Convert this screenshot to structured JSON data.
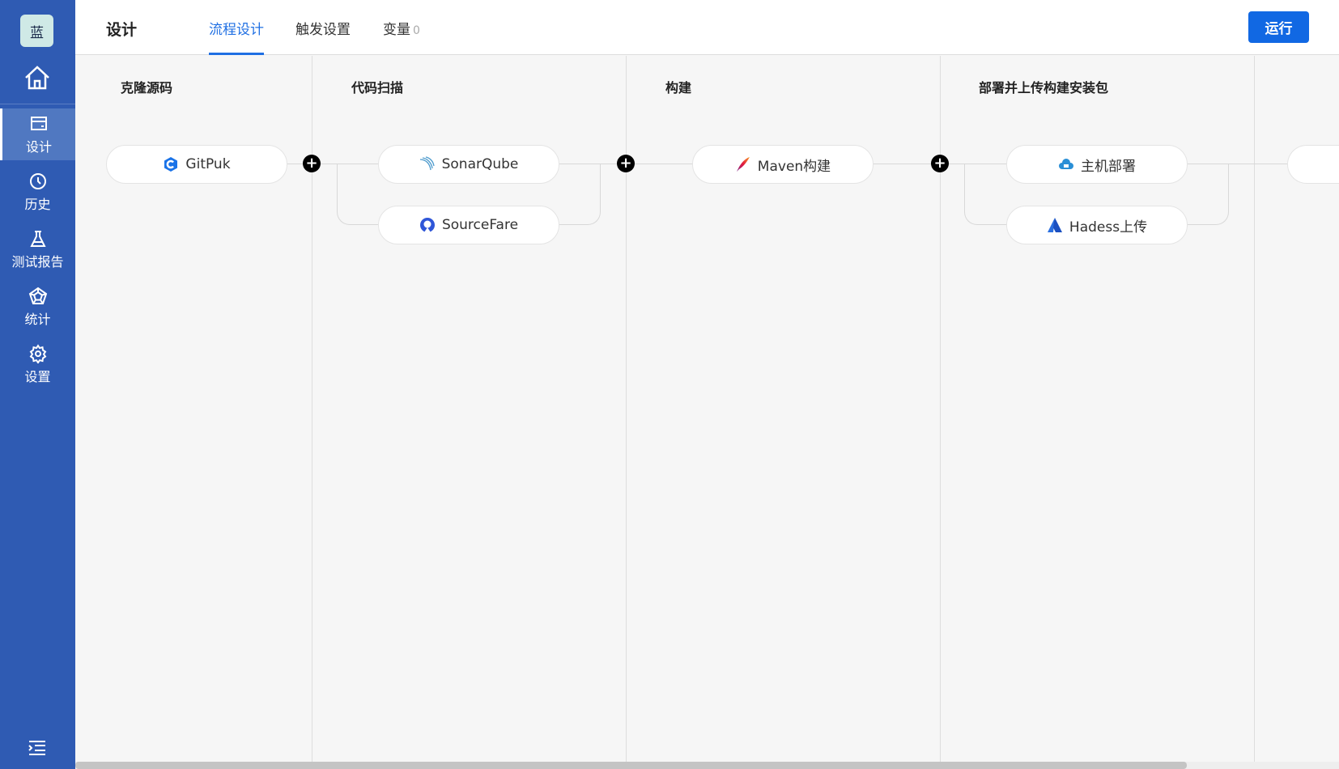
{
  "sidebar": {
    "logo": "蓝",
    "items": [
      {
        "label": "设计",
        "icon": "card-icon",
        "active": true
      },
      {
        "label": "历史",
        "icon": "clock-icon"
      },
      {
        "label": "测试报告",
        "icon": "flask-icon"
      },
      {
        "label": "统计",
        "icon": "pentagon-icon"
      },
      {
        "label": "设置",
        "icon": "gear-icon"
      }
    ]
  },
  "header": {
    "title": "设计",
    "tabs": [
      {
        "label": "流程设计",
        "active": true
      },
      {
        "label": "触发设置"
      },
      {
        "label": "变量",
        "count": "0"
      }
    ],
    "run_label": "运行"
  },
  "stages": [
    {
      "title": "克隆源码",
      "tasks": [
        {
          "label": "GitPuk",
          "icon": "gitpuk-icon"
        }
      ]
    },
    {
      "title": "代码扫描",
      "tasks": [
        {
          "label": "SonarQube",
          "icon": "sonarqube-icon"
        },
        {
          "label": "SourceFare",
          "icon": "sourcefare-icon"
        }
      ]
    },
    {
      "title": "构建",
      "tasks": [
        {
          "label": "Maven构建",
          "icon": "maven-feather-icon"
        }
      ]
    },
    {
      "title": "部署并上传构建安装包",
      "tasks": [
        {
          "label": "主机部署",
          "icon": "cloud-icon"
        },
        {
          "label": "Hadess上传",
          "icon": "hadess-icon"
        }
      ]
    }
  ],
  "colors": {
    "sidebar": "#2f5bb3",
    "accent": "#1168e3"
  }
}
